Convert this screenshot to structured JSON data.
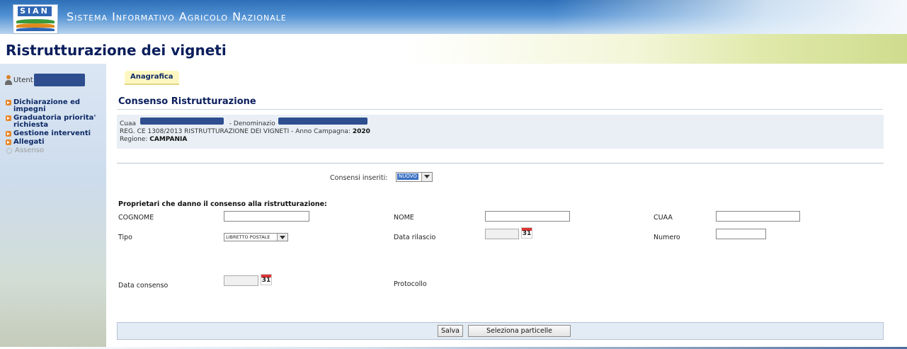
{
  "header": {
    "logo_text": "SIAN",
    "system_title": "Sistema Informativo Agricolo Nazionale"
  },
  "page_title": "Ristrutturazione dei vigneti",
  "sidebar": {
    "user_label": "Utent",
    "menu": [
      {
        "label": "Dichiarazione ed impegni",
        "active": true
      },
      {
        "label": "Graduatoria priorita' richiesta",
        "active": true
      },
      {
        "label": "Gestione interventi",
        "active": true
      },
      {
        "label": "Allegati",
        "active": true
      },
      {
        "label": "Assenso",
        "active": false
      }
    ]
  },
  "tab": {
    "label": "Anagrafica"
  },
  "section_title": "Consenso Ristrutturazione",
  "info": {
    "cuaa_label": "Cuaa",
    "denominazione_label": "- Denominazio",
    "reg_line": "REG. CE 1308/2013 RISTRUTTURAZIONE DEI VIGNETI - Anno Campagna:",
    "anno": "2020",
    "regione_label": "Regione:",
    "regione_value": "CAMPANIA"
  },
  "consensi": {
    "label": "Consensi inseriti:",
    "selected": "NUOVO"
  },
  "form": {
    "section_label": "Proprietari che danno il consenso alla ristrutturazione:",
    "cognome_label": "COGNOME",
    "nome_label": "NOME",
    "cuaa_label": "CUAA",
    "tipo_label": "Tipo",
    "tipo_value": "LIBRETTO POSTALE",
    "data_rilascio_label": "Data rilascio",
    "numero_label": "Numero",
    "data_consenso_label": "Data consenso",
    "protocollo_label": "Protocollo",
    "calendar_day": "31"
  },
  "buttons": {
    "salva": "Salva",
    "seleziona": "Seleziona particelle"
  }
}
